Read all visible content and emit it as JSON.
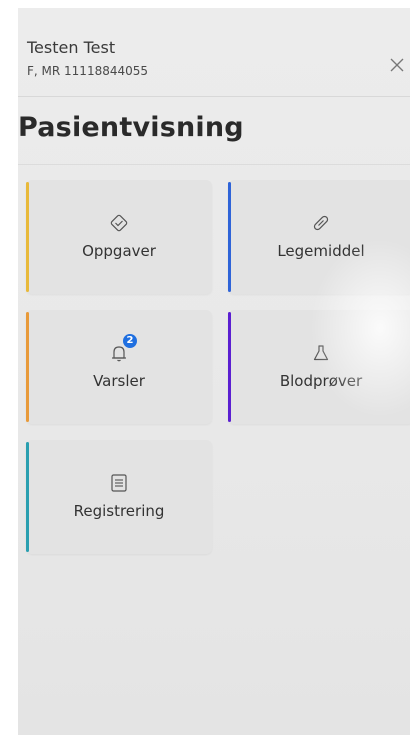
{
  "patient": {
    "name": "Testen Test",
    "meta": "F, MR 11118844055"
  },
  "page": {
    "title": "Pasientvisning"
  },
  "tiles": [
    {
      "label": "Oppgaver",
      "icon": "task-check-icon",
      "stripe_color": "#e8b93a"
    },
    {
      "label": "Legemiddel",
      "icon": "pill-icon",
      "stripe_color": "#2f64d8"
    },
    {
      "label": "Varsler",
      "icon": "bell-icon",
      "stripe_color": "#e89a3a",
      "badge": "2"
    },
    {
      "label": "Blodprøver",
      "icon": "flask-icon",
      "stripe_color": "#5b1fd1"
    },
    {
      "label": "Registrering",
      "icon": "document-icon",
      "stripe_color": "#2a9fb0"
    }
  ],
  "colors": {
    "badge": "#1f6fe0"
  }
}
